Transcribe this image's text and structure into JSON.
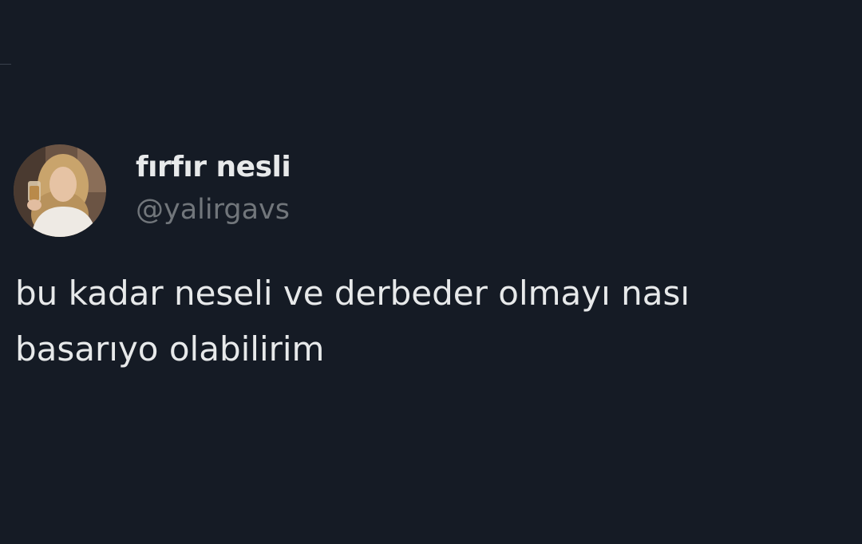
{
  "tweet": {
    "author": {
      "display_name": "fırfır nesli",
      "handle": "@yalirgavs",
      "avatar_icon": "profile-photo"
    },
    "text": "bu kadar neseli ve derbeder olmayı nası\nbasarıyo olabilirim"
  },
  "colors": {
    "background": "#151b25",
    "primary_text": "#e7e9ea",
    "secondary_text": "#71767b"
  }
}
